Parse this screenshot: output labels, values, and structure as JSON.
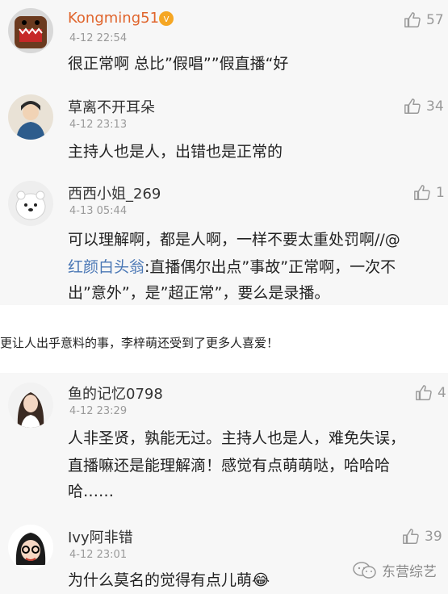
{
  "comments": [
    {
      "user": "Kongming51",
      "time": "4-12 22:54",
      "likes": "57",
      "text": "很正常啊 总比”假唱””假直播“好"
    },
    {
      "user": "草离不开耳朵",
      "time": "4-12 23:13",
      "likes": "34",
      "text": "主持人也是人，出错也是正常的"
    },
    {
      "user": "西西小姐_269",
      "time": "4-13 05:44",
      "likes": "1",
      "text_line1": "可以理解啊，都是人啊，一样不要太重处罚啊//@",
      "mention": "红颜白头翁",
      "text_line2_rest": ":直播偶尔出点”事故”正常啊，一次不",
      "text_line3": "出”意外”，是”超正常”，要么是录播。"
    },
    {
      "user": "鱼的记忆0798",
      "time": "4-12 23:29",
      "likes": "4",
      "text_line1": "人非圣贤，孰能无过。主持人也是人，难免失误，",
      "text_line2": "直播嘛还是能理解滴！感觉有点萌萌哒，哈哈哈",
      "text_line3": "哈……"
    },
    {
      "user": "Ivy阿非错",
      "time": "4-12 23:01",
      "likes": "39",
      "text": "为什么莫名的觉得有点儿萌😂"
    }
  ],
  "banner_text": "更让人出乎意料的事，李梓萌还受到了更多人喜爱！",
  "watermark_text": "东营综艺",
  "icons": {
    "like": "thumbs-up-icon",
    "vip": "vip-badge-icon",
    "watermark_logo": "wechat-logo-icon"
  }
}
